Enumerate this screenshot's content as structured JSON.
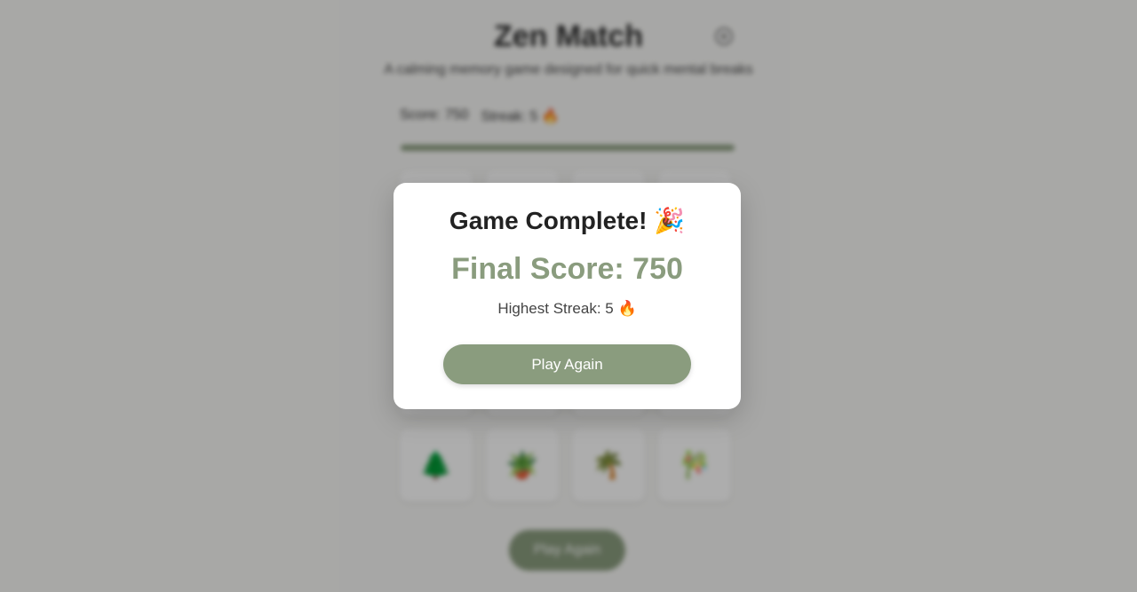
{
  "header": {
    "title": "Zen Match",
    "subtitle": "A calming memory game designed for quick mental breaks"
  },
  "stats": {
    "score_text": "Score: 750",
    "streak_text": "Streak: 5 🔥"
  },
  "progress": {
    "fraction": 1.0
  },
  "board": {
    "visible_row": [
      "🌲",
      "🪴",
      "🌴",
      "🎋"
    ]
  },
  "background_play_label": "Play Again",
  "modal": {
    "title": "Game Complete! 🎉",
    "final_score": "Final Score: 750",
    "highest_streak": "Highest Streak: 5 🔥",
    "play_again_label": "Play Again"
  },
  "colors": {
    "accent": "#8a9c7e",
    "overlay": "rgba(0,0,0,0.32)"
  }
}
